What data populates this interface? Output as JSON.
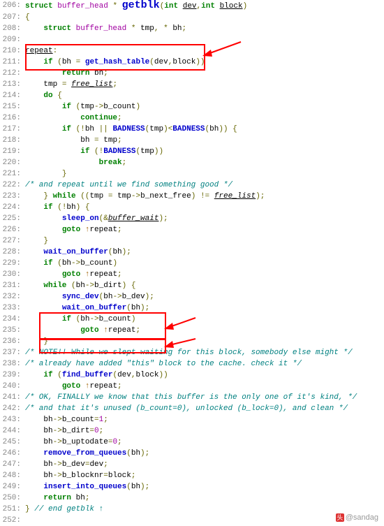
{
  "watermark": "@sandag",
  "lines": [
    {
      "n": 206,
      "h": "<span class='kw'>struct</span> <span class='ty'>buffer_head</span> <span class='op'>*</span> <span class='fn' style='font-size:15px'>getblk</span><span class='op'>(</span><span class='kw'>int</span> <span class='var'>dev</span><span class='op'>,</span><span class='kw'>int</span> <span class='var'>block</span><span class='op'>)</span>"
    },
    {
      "n": 207,
      "h": "<span class='op'>{</span>"
    },
    {
      "n": 208,
      "h": "    <span class='kw'>struct</span> <span class='ty'>buffer_head</span> <span class='op'>*</span> <span class='txt'>tmp</span><span class='op'>,</span> <span class='op'>*</span> <span class='txt'>bh</span><span class='op'>;</span>"
    },
    {
      "n": 209,
      "h": ""
    },
    {
      "n": 210,
      "h": "<span class='var txt'>repeat</span><span class='op'>:</span>"
    },
    {
      "n": 211,
      "h": "    <span class='kw'>if</span> <span class='op'>(</span><span class='txt'>bh</span> <span class='op'>=</span> <span class='fn'>get_hash_table</span><span class='op'>(</span><span class='txt'>dev</span><span class='op'>,</span><span class='txt'>block</span><span class='op'>))</span>"
    },
    {
      "n": 212,
      "h": "        <span class='kw'>return</span> <span class='txt'>bh</span><span class='op'>;</span>"
    },
    {
      "n": 213,
      "h": "    <span class='txt'>tmp</span> <span class='op'>=</span> <span class='var txt' style='font-style:italic'>free_list</span><span class='op'>;</span>"
    },
    {
      "n": 214,
      "h": "    <span class='kw'>do</span> <span class='op'>{</span>"
    },
    {
      "n": 215,
      "h": "        <span class='kw'>if</span> <span class='op'>(</span><span class='txt'>tmp</span><span class='op'>-&gt;</span><span class='txt'>b_count</span><span class='op'>)</span>"
    },
    {
      "n": 216,
      "h": "            <span class='kw'>continue</span><span class='op'>;</span>"
    },
    {
      "n": 217,
      "h": "        <span class='kw'>if</span> <span class='op'>(!</span><span class='txt'>bh</span> <span class='op'>||</span> <span class='fn'>BADNESS</span><span class='op'>(</span><span class='txt'>tmp</span><span class='op'>)&lt;</span><span class='fn'>BADNESS</span><span class='op'>(</span><span class='txt'>bh</span><span class='op'>))</span> <span class='op'>{</span>"
    },
    {
      "n": 218,
      "h": "            <span class='txt'>bh</span> <span class='op'>=</span> <span class='txt'>tmp</span><span class='op'>;</span>"
    },
    {
      "n": 219,
      "h": "            <span class='kw'>if</span> <span class='op'>(!</span><span class='fn'>BADNESS</span><span class='op'>(</span><span class='txt'>tmp</span><span class='op'>))</span>"
    },
    {
      "n": 220,
      "h": "                <span class='kw'>break</span><span class='op'>;</span>"
    },
    {
      "n": 221,
      "h": "        <span class='op'>}</span>"
    },
    {
      "n": 222,
      "h": "<span class='cm'>/* and repeat until we find something good */</span>"
    },
    {
      "n": 223,
      "h": "    <span class='op'>}</span> <span class='kw'>while</span> <span class='op'>((</span><span class='txt'>tmp</span> <span class='op'>=</span> <span class='txt'>tmp</span><span class='op'>-&gt;</span><span class='txt'>b_next_free</span><span class='op'>)</span> <span class='op'>!=</span> <span class='var txt' style='font-style:italic'>free_list</span><span class='op'>);</span>"
    },
    {
      "n": 224,
      "h": "    <span class='kw'>if</span> <span class='op'>(!</span><span class='txt'>bh</span><span class='op'>)</span> <span class='op'>{</span>"
    },
    {
      "n": 225,
      "h": "        <span class='fn'>sleep_on</span><span class='op'>(&amp;</span><span class='var txt' style='font-style:italic'>buffer_wait</span><span class='op'>);</span>"
    },
    {
      "n": 226,
      "h": "        <span class='kw'>goto</span> <span style='color:#a06000'>↑</span><span class='txt'>repeat</span><span class='op'>;</span>"
    },
    {
      "n": 227,
      "h": "    <span class='op'>}</span>"
    },
    {
      "n": 228,
      "h": "    <span class='fn'>wait_on_buffer</span><span class='op'>(</span><span class='txt'>bh</span><span class='op'>);</span>"
    },
    {
      "n": 229,
      "h": "    <span class='kw'>if</span> <span class='op'>(</span><span class='txt'>bh</span><span class='op'>-&gt;</span><span class='txt'>b_count</span><span class='op'>)</span>"
    },
    {
      "n": 230,
      "h": "        <span class='kw'>goto</span> <span style='color:#a06000'>↑</span><span class='txt'>repeat</span><span class='op'>;</span>"
    },
    {
      "n": 231,
      "h": "    <span class='kw'>while</span> <span class='op'>(</span><span class='txt'>bh</span><span class='op'>-&gt;</span><span class='txt'>b_dirt</span><span class='op'>)</span> <span class='op'>{</span>"
    },
    {
      "n": 232,
      "h": "        <span class='fn'>sync_dev</span><span class='op'>(</span><span class='txt'>bh</span><span class='op'>-&gt;</span><span class='txt'>b_dev</span><span class='op'>);</span>"
    },
    {
      "n": 233,
      "h": "        <span class='fn'>wait_on_buffer</span><span class='op'>(</span><span class='txt'>bh</span><span class='op'>);</span>"
    },
    {
      "n": 234,
      "h": "        <span class='kw'>if</span> <span class='op'>(</span><span class='txt'>bh</span><span class='op'>-&gt;</span><span class='txt'>b_count</span><span class='op'>)</span>"
    },
    {
      "n": 235,
      "h": "            <span class='kw'>goto</span> <span style='color:#a06000'>↑</span><span class='txt'>repeat</span><span class='op'>;</span>"
    },
    {
      "n": 236,
      "h": "    <span class='op'>}</span>"
    },
    {
      "n": 237,
      "h": "<span class='cm'>/* NOTE!! While we slept waiting for this block, somebody else might */</span>"
    },
    {
      "n": 238,
      "h": "<span class='cm'>/* already have added \"this\" block to the cache. check it */</span>"
    },
    {
      "n": 239,
      "h": "    <span class='kw'>if</span> <span class='op'>(</span><span class='fn'>find_buffer</span><span class='op'>(</span><span class='txt'>dev</span><span class='op'>,</span><span class='txt'>block</span><span class='op'>))</span>"
    },
    {
      "n": 240,
      "h": "        <span class='kw'>goto</span> <span style='color:#a06000'>↑</span><span class='txt'>repeat</span><span class='op'>;</span>"
    },
    {
      "n": 241,
      "h": "<span class='cm'>/* OK, FINALLY we know that this buffer is the only one of it's kind, */</span>"
    },
    {
      "n": 242,
      "h": "<span class='cm'>/* and that it's unused (b_count=0), unlocked (b_lock=0), and clean */</span>"
    },
    {
      "n": 243,
      "h": "    <span class='txt'>bh</span><span class='op'>-&gt;</span><span class='txt'>b_count</span><span class='op'>=</span><span style='color:#a000a0'>1</span><span class='op'>;</span>"
    },
    {
      "n": 244,
      "h": "    <span class='txt'>bh</span><span class='op'>-&gt;</span><span class='txt'>b_dirt</span><span class='op'>=</span><span style='color:#a000a0'>0</span><span class='op'>;</span>"
    },
    {
      "n": 245,
      "h": "    <span class='txt'>bh</span><span class='op'>-&gt;</span><span class='txt'>b_uptodate</span><span class='op'>=</span><span style='color:#a000a0'>0</span><span class='op'>;</span>"
    },
    {
      "n": 246,
      "h": "    <span class='fn'>remove_from_queues</span><span class='op'>(</span><span class='txt'>bh</span><span class='op'>);</span>"
    },
    {
      "n": 247,
      "h": "    <span class='txt'>bh</span><span class='op'>-&gt;</span><span class='txt'>b_dev</span><span class='op'>=</span><span class='txt'>dev</span><span class='op'>;</span>"
    },
    {
      "n": 248,
      "h": "    <span class='txt'>bh</span><span class='op'>-&gt;</span><span class='txt'>b_blocknr</span><span class='op'>=</span><span class='txt'>block</span><span class='op'>;</span>"
    },
    {
      "n": 249,
      "h": "    <span class='fn'>insert_into_queues</span><span class='op'>(</span><span class='txt'>bh</span><span class='op'>);</span>"
    },
    {
      "n": 250,
      "h": "    <span class='kw'>return</span> <span class='txt'>bh</span><span class='op'>;</span>"
    },
    {
      "n": 251,
      "h": "<span class='op'>}</span> <span class='cm'>// end getblk ↑</span>"
    },
    {
      "n": 252,
      "h": ""
    }
  ]
}
